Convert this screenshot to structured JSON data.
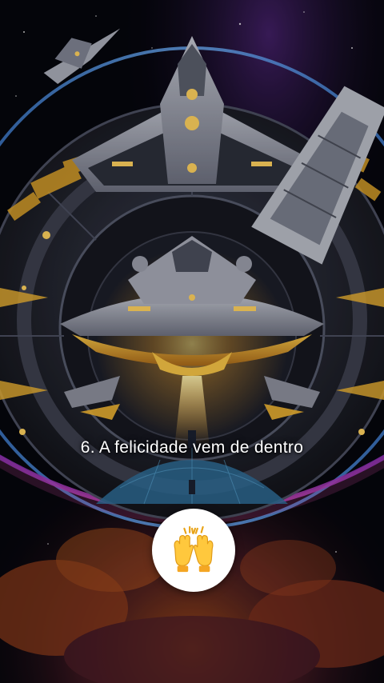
{
  "caption": "6. A felicidade vem de dentro",
  "reaction": {
    "icon": "raising-hands-icon"
  },
  "colors": {
    "space_background": "#05060c",
    "planet_rim_blue": "#3a7bd5",
    "planet_rim_magenta": "#c03fa8",
    "ship_light_yellow": "#f2b632",
    "ship_hull_gray": "#8c8f9c",
    "nebula_orange": "#d9641c"
  }
}
